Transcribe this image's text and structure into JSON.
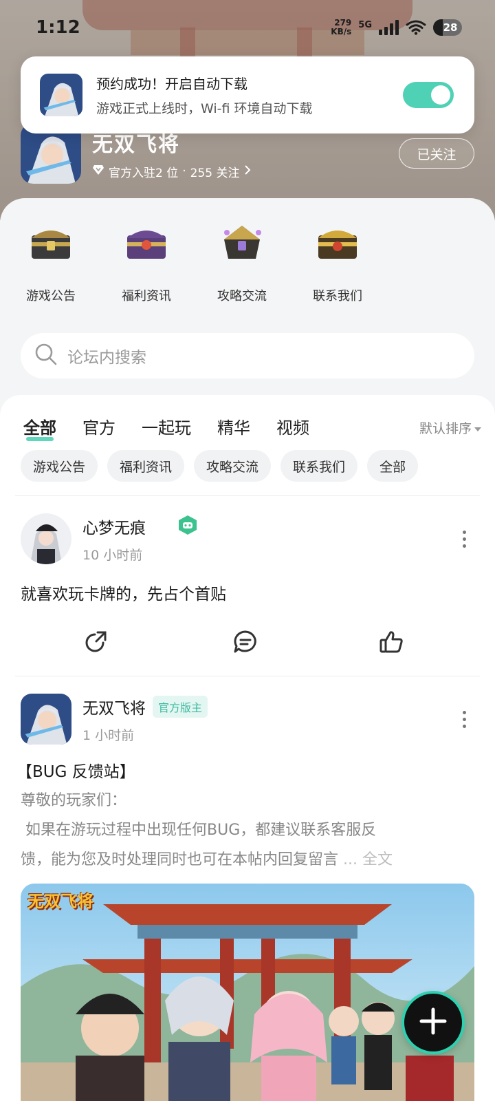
{
  "status_bar": {
    "time": "1:12",
    "net_speed_value": "279",
    "net_speed_unit": "KB/s",
    "network_type": "5G",
    "battery": "28"
  },
  "toast": {
    "title": "预约成功！开启自动下载",
    "subtitle": "游戏正式上线时，Wi-fi 环境自动下载",
    "toggle_on": true,
    "accent_color": "#4fd1b6"
  },
  "game": {
    "name": "无双飞将",
    "rank_text": "官方入驻2 位",
    "separator": "·",
    "followers_text": "255 关注",
    "follow_button": "已关注"
  },
  "quick_nav": [
    {
      "label": "游戏公告",
      "icon": "treasure-chest-icon"
    },
    {
      "label": "福利资讯",
      "icon": "treasure-chest-icon"
    },
    {
      "label": "攻略交流",
      "icon": "treasure-chest-icon"
    },
    {
      "label": "联系我们",
      "icon": "treasure-chest-icon"
    }
  ],
  "search": {
    "placeholder": "论坛内搜索"
  },
  "tabs": [
    {
      "label": "全部",
      "active": true
    },
    {
      "label": "官方",
      "active": false
    },
    {
      "label": "一起玩",
      "active": false
    },
    {
      "label": "精华",
      "active": false
    },
    {
      "label": "视频",
      "active": false
    }
  ],
  "sort_label": "默认排序",
  "chips": [
    "游戏公告",
    "福利资讯",
    "攻略交流",
    "联系我们",
    "全部"
  ],
  "posts": [
    {
      "author": "心梦无痕",
      "time": "10 小时前",
      "content": "就喜欢玩卡牌的，先占个首贴",
      "badge_icon": "gamepad-badge-icon"
    },
    {
      "author": "无双飞将",
      "badge": "官方版主",
      "time": "1 小时前",
      "title": "【BUG 反馈站】",
      "excerpt_line1": "尊敬的玩家们：",
      "excerpt_line2": " 如果在游玩过程中出现任何BUG，都建议联系客服反",
      "excerpt_line3": "馈，能为您及时处理同时也可在本帖内回复留言",
      "ellipsis": "...",
      "read_more": "全文",
      "banner_logo": "无双飞将"
    }
  ]
}
